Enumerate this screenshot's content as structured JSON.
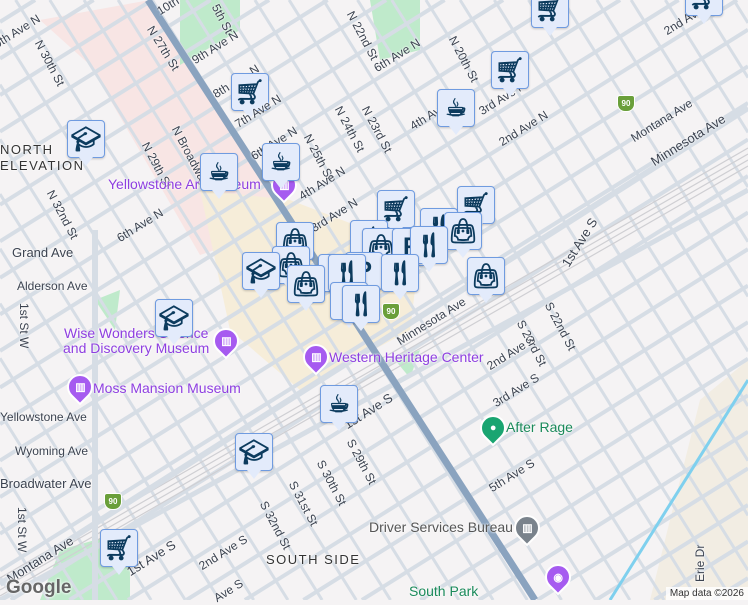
{
  "map": {
    "neighborhoods": [
      "NORTH ELEVATION",
      "SOUTH SIDE"
    ],
    "streets": {
      "n27": "N 27th St",
      "n22": "N 22nd St",
      "n20": "N 20th St",
      "n23": "N 23rd St",
      "n24": "N 24th St",
      "n25": "N 25th St",
      "n29": "N 29th St",
      "n30": "N 30th St",
      "n32": "N 32nd St",
      "nbroadway": "N Broadway",
      "a10": "10th",
      "s5th": "5th St",
      "a9": "9th Ave N",
      "a8": "8th Ave N",
      "a7": "7th Ave N",
      "a6a": "6th Ave N",
      "a6b": "6th Ave N",
      "a6c": "6th Ave N",
      "a6d": "9th Ave N",
      "a4a": "4th Ave N",
      "a4b": "4th Ave N",
      "a3a": "3rd Ave N",
      "a3b": "3rd Ave N",
      "a2a": "2nd Ave N",
      "a2b": "2nd Ave N",
      "grand": "Grand Ave",
      "alderson": "Alderson Ave",
      "yellowstone": "Yellowstone Ave",
      "wyoming": "Wyoming Ave",
      "broadwater": "Broadwater Ave",
      "first_w1": "1st St W",
      "first_w2": "1st St W",
      "montana1": "Montana Ave",
      "montana2": "Montana Ave",
      "minnesota1": "Minnesota Ave",
      "minnesota2": "Minnesota Ave",
      "first_s1": "1st Ave S",
      "first_s2": "1st Ave S",
      "first_s3": "1st Ave S",
      "second_s1": "2nd Ave S",
      "second_s2": "2nd Ave S",
      "third_s": "3rd Ave S",
      "fifth_s": "5th Ave S",
      "s22": "S 22nd St",
      "s23": "S 23rd St",
      "s29": "S 29th St",
      "s30": "S 30th St",
      "s31": "S 31st St",
      "s32": "S 32nd St",
      "erie": "Erie Dr",
      "ave_s": "Ave S"
    },
    "interstate": "90",
    "places": {
      "yellowstone_museum": "Yellowstone Art Museum",
      "wise_wonders_1": "Wise Wonders Science",
      "wise_wonders_2": "and Discovery Museum",
      "moss": "Moss Mansion Museum",
      "western": "Western Heritage Center",
      "after_rage": "After Rage",
      "driver": "Driver Services Bureau",
      "south_park": "South Park"
    },
    "marker_icons": [
      "cart-icon",
      "school-icon",
      "cup-icon",
      "bag-icon",
      "parking-icon",
      "restaurant-icon"
    ],
    "attribution": "Map data ©2026",
    "logo": "Google"
  },
  "colors": {
    "marker_bg": "#e3ebfb",
    "marker_icon": "#0c3b5e",
    "poi": "#8e3ee0",
    "park": "#bfeacb",
    "highway": "#8aa3bf"
  }
}
